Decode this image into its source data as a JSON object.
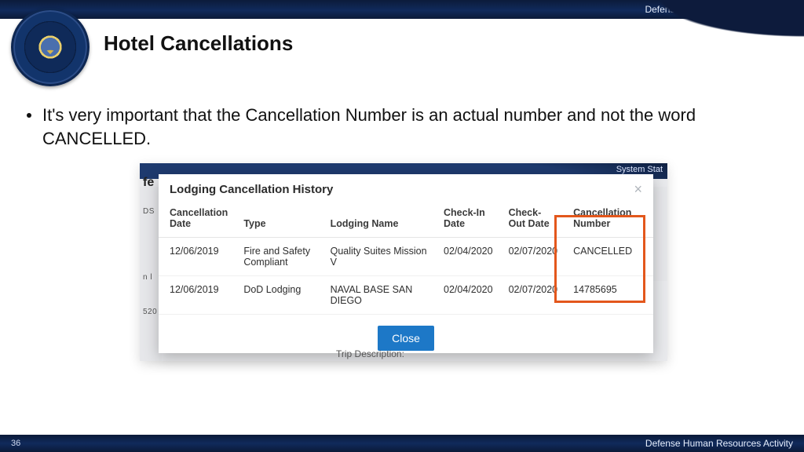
{
  "header": {
    "org": "Defense Travel Management Office"
  },
  "title": "Hotel Cancellations",
  "bullet": "It's very important that the Cancellation Number is an actual number and not the word CANCELLED.",
  "screenshot": {
    "partial_left_label": "fe",
    "system_label": "System Stat",
    "side_frag_b": "DS",
    "side_frag_c": "n l",
    "side_frag_d": "520",
    "trip_desc_label": "Trip Description:",
    "modal": {
      "title": "Lodging Cancellation History",
      "close_button": "Close",
      "columns": {
        "cancel_date": "Cancellation Date",
        "type": "Type",
        "lodging_name": "Lodging Name",
        "checkin": "Check-In Date",
        "checkout": "Check-Out Date",
        "cancel_no": "Cancellation Number"
      },
      "rows": [
        {
          "cancel_date": "12/06/2019",
          "type": "Fire and Safety Compliant",
          "lodging_name": "Quality Suites Mission V",
          "checkin": "02/04/2020",
          "checkout": "02/07/2020",
          "cancel_no": "CANCELLED"
        },
        {
          "cancel_date": "12/06/2019",
          "type": "DoD Lodging",
          "lodging_name": "NAVAL BASE SAN DIEGO",
          "checkin": "02/04/2020",
          "checkout": "02/07/2020",
          "cancel_no": "14785695"
        }
      ]
    }
  },
  "footer": {
    "page": "36",
    "activity": "Defense Human Resources Activity"
  }
}
